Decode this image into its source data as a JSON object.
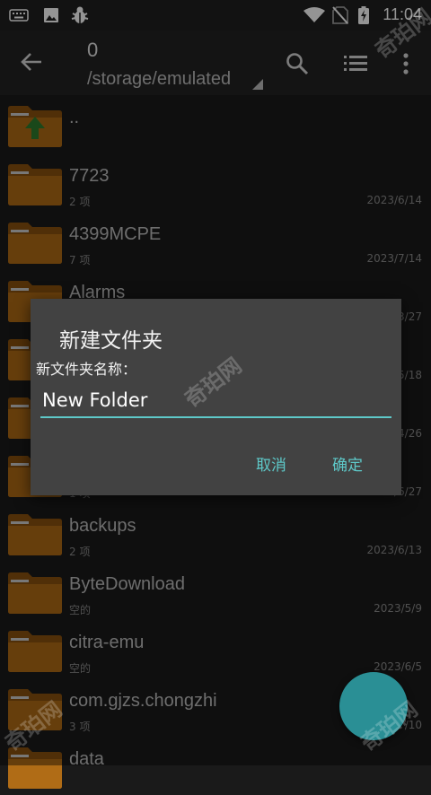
{
  "status_bar": {
    "time": "11:04",
    "icons": [
      "keyboard-icon",
      "image-icon",
      "bug-icon",
      "wifi-icon",
      "no-sim-icon",
      "battery-charging-icon"
    ]
  },
  "app_bar": {
    "count": "0",
    "path": "/storage/emulated",
    "icons": [
      "back-arrow-icon",
      "search-icon",
      "list-view-icon",
      "more-vert-icon"
    ]
  },
  "files": [
    {
      "name": "..",
      "sub": "",
      "date": "",
      "parent": true
    },
    {
      "name": "7723",
      "sub": "2 项",
      "date": "2023/6/14"
    },
    {
      "name": "4399MCPE",
      "sub": "7 项",
      "date": "2023/7/14"
    },
    {
      "name": "Alarms",
      "sub": "",
      "date": "3/27"
    },
    {
      "name": "",
      "sub": "",
      "date": "5/18"
    },
    {
      "name": "",
      "sub": "",
      "date": "4/26"
    },
    {
      "name": "",
      "sub": "1 项",
      "date": "2023/6/27"
    },
    {
      "name": "backups",
      "sub": "2 项",
      "date": "2023/6/13"
    },
    {
      "name": "ByteDownload",
      "sub": "空的",
      "date": "2023/5/9"
    },
    {
      "name": "citra-emu",
      "sub": "空的",
      "date": "2023/6/5"
    },
    {
      "name": "com.gjzs.chongzhi",
      "sub": "3 项",
      "date": "/10"
    },
    {
      "name": "data",
      "sub": "",
      "date": ""
    }
  ],
  "dialog": {
    "title": "新建文件夹",
    "label": "新文件夹名称：",
    "input_value": "New Folder",
    "cancel": "取消",
    "ok": "确定"
  },
  "watermark": "奇珀网",
  "colors": {
    "accent": "#5ec9c9",
    "fab": "#2a8f95",
    "folder": "#b06c16",
    "dialog_bg": "#424242"
  }
}
